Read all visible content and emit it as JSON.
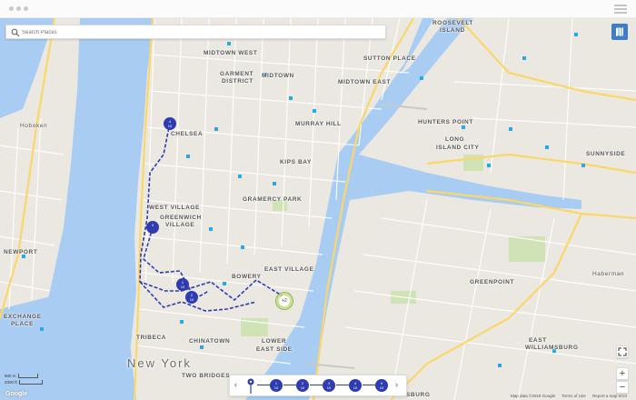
{
  "search": {
    "placeholder": "Search Places"
  },
  "neighborhoods": [
    {
      "name": "ROOSEVELT"
    },
    {
      "name": "ISLAND"
    },
    {
      "name": "MIDTOWN WEST"
    },
    {
      "name": "GARMENT"
    },
    {
      "name": "DISTRICT"
    },
    {
      "name": "MIDTOWN"
    },
    {
      "name": "SUTTON PLACE"
    },
    {
      "name": "MIDTOWN EAST"
    },
    {
      "name": "HUNTERS POINT"
    },
    {
      "name": "LONG"
    },
    {
      "name": "ISLAND CITY"
    },
    {
      "name": "SUNNYSIDE"
    },
    {
      "name": "CHELSEA"
    },
    {
      "name": "MURRAY HILL"
    },
    {
      "name": "KIPS BAY"
    },
    {
      "name": "GRAMERCY PARK"
    },
    {
      "name": "WEST VILLAGE"
    },
    {
      "name": "GREENWICH"
    },
    {
      "name": "VILLAGE"
    },
    {
      "name": "BOWERY"
    },
    {
      "name": "EAST VILLAGE"
    },
    {
      "name": "NEWPORT"
    },
    {
      "name": "EXCHANGE"
    },
    {
      "name": "PLACE"
    },
    {
      "name": "TRIBECA"
    },
    {
      "name": "CHINATOWN"
    },
    {
      "name": "LOWER"
    },
    {
      "name": "EAST SIDE"
    },
    {
      "name": "TWO BRIDGES"
    },
    {
      "name": "GREENPOINT"
    },
    {
      "name": "EAST"
    },
    {
      "name": "WILLIAMSBURG"
    },
    {
      "name": "WILLIAMSBURG"
    },
    {
      "name": "Haberman"
    },
    {
      "name": "Hoboken"
    }
  ],
  "city_label": "New York",
  "route_stops": [
    {
      "number": "4",
      "sub": "10"
    },
    {
      "number": "3",
      "sub": ""
    },
    {
      "number": "1",
      "sub": "10"
    },
    {
      "number": "2",
      "sub": "10"
    }
  ],
  "cluster": {
    "label": "+2"
  },
  "timeline": {
    "prev": "‹",
    "next": "›",
    "nodes": [
      {
        "top": "1",
        "bottom": "10"
      },
      {
        "top": "2",
        "bottom": "10"
      },
      {
        "top": "3",
        "bottom": "10"
      },
      {
        "top": "4",
        "bottom": "10"
      },
      {
        "top": "5",
        "bottom": "10"
      }
    ]
  },
  "controls": {
    "zoom_in": "+",
    "zoom_out": "−"
  },
  "scale": {
    "meters": "500 m",
    "feet": "2000 ft"
  },
  "attribution": {
    "map_data": "Map data ©2018 Google",
    "terms": "Terms of Use",
    "report": "Report a map error",
    "google": "Google"
  },
  "colors": {
    "water": "#a9cdf2",
    "land": "#ebe8e1",
    "park": "#cfe3b6",
    "highway": "#fbd769",
    "route": "#2e3cb0",
    "accent": "#3f7dc4"
  },
  "icons": [
    "search-icon",
    "map-layers-icon",
    "menu-icon",
    "fullscreen-icon",
    "location-pin-icon"
  ]
}
